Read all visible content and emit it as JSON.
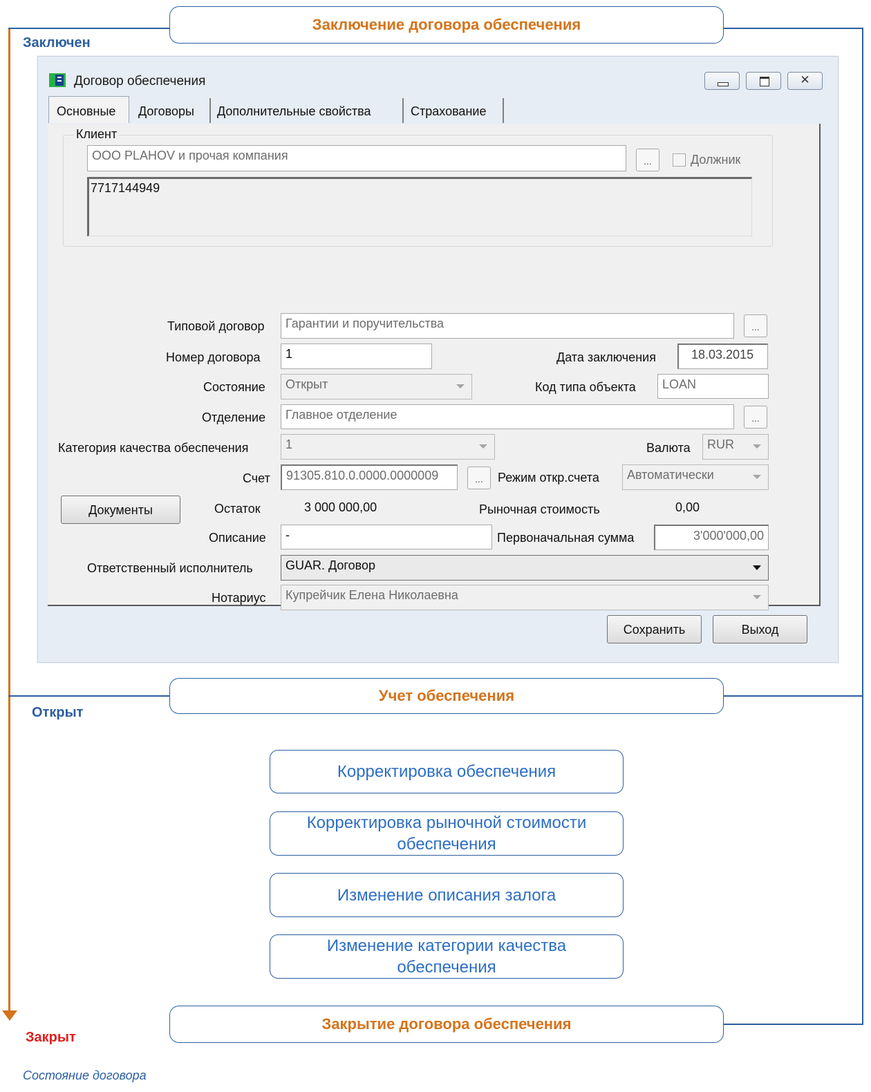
{
  "diagram": {
    "stages": {
      "conclude": "Заключение договора обеспечения",
      "accounting": "Учет обеспечения",
      "close": "Закрытие договора обеспечения"
    },
    "states": {
      "concluded": "Заключен",
      "open": "Открыт",
      "closed": "Закрыт"
    },
    "actions": [
      {
        "label": "Корректировка обеспечения"
      },
      {
        "label": "Корректировка рыночной стоимости обеспечения"
      },
      {
        "label": "Изменение описания залога"
      },
      {
        "label": "Изменение категории качества обеспечения"
      }
    ],
    "caption": "Состояние договора",
    "colors": {
      "orange": "#d4741c",
      "blue": "#2d5fa0",
      "link": "#2e6fc4",
      "closed": "#e0201c"
    }
  },
  "window": {
    "title": "Договор обеспечения",
    "close_glyph": "✕",
    "tabs": [
      {
        "label": "Основные"
      },
      {
        "label": "Договоры"
      },
      {
        "label": "Дополнительные свойства"
      },
      {
        "label": "Страхование"
      }
    ],
    "client": {
      "legend": "Клиент",
      "name": "ООО PLAHOV и прочая компания",
      "debtor_label": "Должник",
      "inn": "7717144949"
    },
    "dots_label": "...",
    "form": {
      "typical_contract_label": "Типовой договор",
      "typical_contract_value": "Гарантии и поручительства",
      "contract_number_label": "Номер договора",
      "contract_number_value": "1",
      "conclusion_date_label": "Дата заключения",
      "conclusion_date_value": "18.03.2015",
      "state_label": "Состояние",
      "state_value": "Открыт",
      "object_type_label": "Код типа объекта",
      "object_type_value": "LOAN",
      "branch_label": "Отделение",
      "branch_value": "Главное отделение",
      "quality_label": "Категория качества обеспечения",
      "quality_value": "1",
      "currency_label": "Валюта",
      "currency_value": "RUR",
      "account_label": "Счет",
      "account_value": "91305.810.0.0000.0000009",
      "account_mode_label": "Режим откр.счета",
      "account_mode_value": "Автоматически",
      "documents_button": "Документы",
      "balance_label": "Остаток",
      "balance_value": "3 000 000,00",
      "market_value_label": "Рыночная стоимость",
      "market_value_value": "0,00",
      "description_label": "Описание",
      "description_value": "-",
      "initial_sum_label": "Первоначальная сумма",
      "initial_sum_value": "3'000'000,00",
      "executor_label": "Ответственный исполнитель",
      "executor_value": "GUAR. Договор",
      "notary_label": "Нотариус",
      "notary_value": "Купрейчик Елена Николаевна"
    },
    "buttons": {
      "save": "Сохранить",
      "exit": "Выход"
    }
  }
}
